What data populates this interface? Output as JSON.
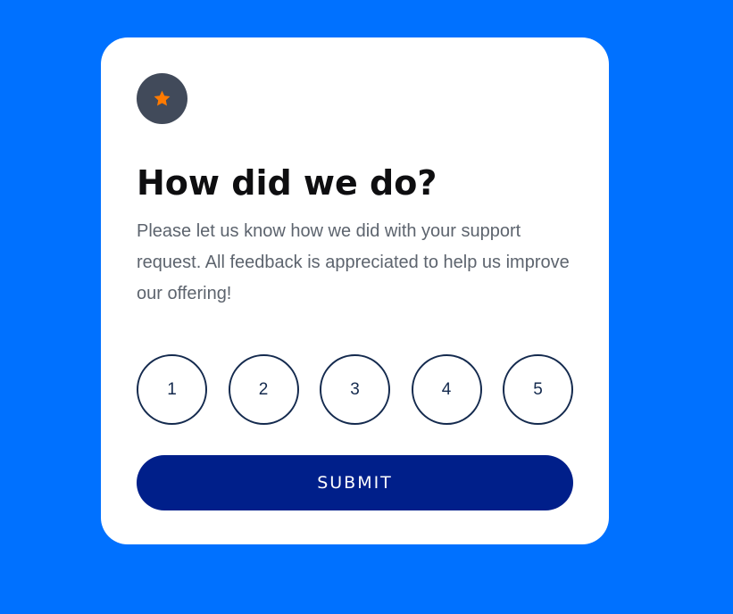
{
  "colors": {
    "page_background": "#0071ff",
    "card_background": "#ffffff",
    "badge_background": "#414a5a",
    "star": "#ff7a00",
    "title": "#0e0e10",
    "description": "#5d646e",
    "rating_border": "#142a4e",
    "submit_background": "#001f8a",
    "submit_text": "#ffffff"
  },
  "card": {
    "badge_icon": "star-icon",
    "title": "How did we do?",
    "description": "Please let us know how we did with your support request. All feedback is appreciated to help us improve our offering!",
    "ratings": [
      {
        "label": "1"
      },
      {
        "label": "2"
      },
      {
        "label": "3"
      },
      {
        "label": "4"
      },
      {
        "label": "5"
      }
    ],
    "submit_label": "SUBMIT"
  }
}
